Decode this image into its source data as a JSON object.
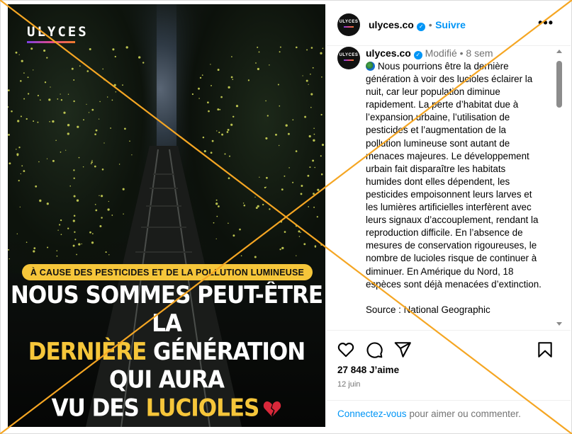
{
  "image_panel": {
    "logo": "ULYCES",
    "banner": "À CAUSE DES PESTICIDES ET DE LA POLLUTION LUMINEUSE",
    "headline": {
      "line1": "NOUS SOMMES PEUT-ÊTRE LA",
      "line2_highlight": "DERNIÈRE",
      "line2_rest": " GÉNÉRATION QUI AURA",
      "line3_start": "VU DES ",
      "line3_highlight": "LUCIOLES"
    }
  },
  "header": {
    "username": "ulyces.co",
    "separator": "•",
    "follow_label": "Suivre",
    "more_label": "•••"
  },
  "caption": {
    "username": "ulyces.co",
    "meta": "Modifié • 8 sem",
    "text": "Nous pourrions être la dernière génération à voir des lucioles éclairer la nuit, car leur population diminue rapidement. La perte d’habitat due à l’expansion urbaine, l’utilisation de pesticides et l’augmentation de la pollution lumineuse sont autant de menaces majeures. Le développement urbain fait disparaître les habitats humides dont elles dépendent, les pesticides empoisonnent leurs larves et les lumières artificielles interfèrent avec leurs signaux d’accouplement, rendant la reproduction difficile. En l’absence de mesures de conservation rigoureuses, le nombre de lucioles risque de continuer à diminuer. En Amérique du Nord, 18 espèces sont déjà menacées d’extinction.",
    "source": "Source : National Geographic"
  },
  "stats": {
    "likes": "27 848 J’aime",
    "date": "12 juin"
  },
  "login_prompt": {
    "link": "Connectez-vous",
    "rest": " pour aimer ou commenter."
  },
  "colors": {
    "accent_blue": "#0095f6",
    "highlight_yellow": "#f6c63a",
    "overlay_cross": "#f5a623"
  },
  "icons": [
    "heart-icon",
    "comment-icon",
    "share-icon",
    "bookmark-icon",
    "verified-badge-icon",
    "globe-emoji-icon",
    "broken-heart-emoji-icon"
  ]
}
